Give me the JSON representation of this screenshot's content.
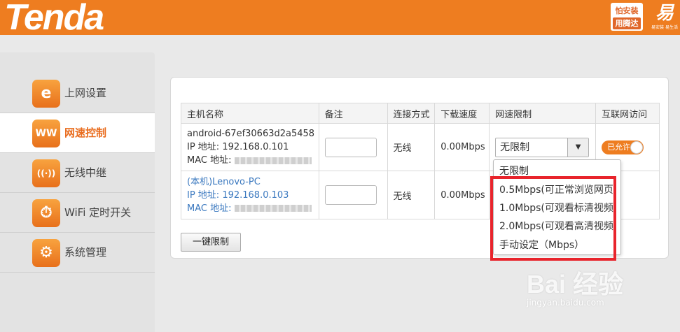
{
  "header": {
    "logo_text": "Tenda",
    "badge_line1": "怕安装",
    "badge_line2": "用腾达",
    "easy_mark": "易",
    "easy_sub": "易安装 易生活"
  },
  "sidebar": {
    "items": [
      {
        "label": "上网设置",
        "icon": "e",
        "active": false
      },
      {
        "label": "网速控制",
        "icon": "WW",
        "active": true
      },
      {
        "label": "无线中继",
        "icon": "((·))",
        "active": false
      },
      {
        "label": "WiFi 定时开关",
        "icon": "⏱",
        "active": false
      },
      {
        "label": "系统管理",
        "icon": "⚙",
        "active": false
      }
    ]
  },
  "table": {
    "headers": [
      "主机名称",
      "备注",
      "连接方式",
      "下载速度",
      "网速限制",
      "互联网访问"
    ],
    "rows": [
      {
        "host": "android-67ef30663d2a5458",
        "ip": "IP 地址: 192.168.0.101",
        "mac_label": "MAC 地址:",
        "connection": "无线",
        "speed": "0.00Mbps",
        "limit": "无限制",
        "toggle_label": "已允许"
      },
      {
        "host": "(本机)Lenovo-PC",
        "ip": "IP 地址: 192.168.0.103",
        "mac_label": "MAC 地址:",
        "connection": "无线",
        "speed": "0.00Mbps"
      }
    ]
  },
  "limit_button": "一键限制",
  "dropdown": {
    "options": [
      "无限制",
      "0.5Mbps(可正常浏览网页",
      "1.0Mbps(可观看标清视频",
      "2.0Mbps(可观看高清视频",
      "手动设定（Mbps）"
    ]
  },
  "watermark": {
    "brand": "Bai 经验",
    "url": "jingyan.baidu.com"
  },
  "colors": {
    "brand_orange": "#ee7d20",
    "highlight_red": "#e8242c",
    "link_blue": "#3a78bf"
  }
}
